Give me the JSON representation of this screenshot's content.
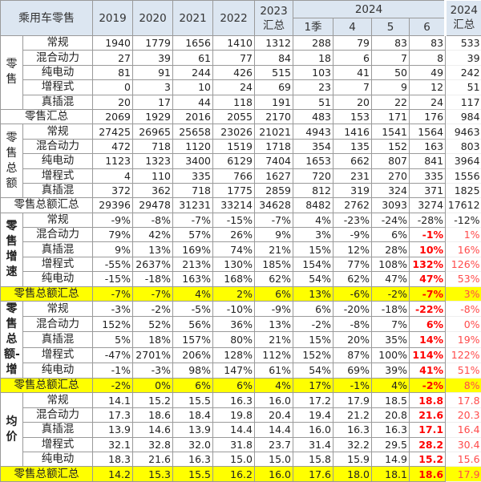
{
  "header": {
    "title": "乘用车零售",
    "years": [
      "2019",
      "2020",
      "2021",
      "2022"
    ],
    "y2023": "2023",
    "y2023_sub": "汇总",
    "y2024": "2024",
    "y2024_subs": [
      "1季",
      "4",
      "5",
      "6"
    ],
    "y2024_total": "2024",
    "y2024_total_sub": "汇总"
  },
  "colors": {
    "highlight_row": "#ffff00",
    "header_bg": "#dce6f1",
    "red": "#ff0000"
  },
  "sections": [
    {
      "label": "零售",
      "rows": [
        {
          "name": "常规",
          "values": [
            "1940",
            "1779",
            "1656",
            "1410",
            "1312",
            "288",
            "79",
            "83",
            "83",
            "533"
          ],
          "red": false
        },
        {
          "name": "混合动力",
          "values": [
            "27",
            "39",
            "61",
            "77",
            "84",
            "18",
            "6",
            "7",
            "8",
            "39"
          ],
          "red": false
        },
        {
          "name": "纯电动",
          "values": [
            "81",
            "91",
            "244",
            "426",
            "515",
            "103",
            "41",
            "50",
            "49",
            "242"
          ],
          "red": false
        },
        {
          "name": "增程式",
          "values": [
            "0",
            "3",
            "10",
            "24",
            "69",
            "23",
            "7",
            "9",
            "12",
            "51"
          ],
          "red": false
        },
        {
          "name": "真插混",
          "values": [
            "20",
            "17",
            "44",
            "118",
            "191",
            "51",
            "20",
            "22",
            "24",
            "117"
          ],
          "red": false
        }
      ],
      "summary": {
        "name": "零售汇总",
        "values": [
          "2069",
          "1929",
          "2016",
          "2055",
          "2170",
          "483",
          "153",
          "171",
          "176",
          "984"
        ],
        "yellow": false,
        "red": false
      }
    },
    {
      "label": "零售总额",
      "rows": [
        {
          "name": "常规",
          "values": [
            "27425",
            "26965",
            "25658",
            "23026",
            "21021",
            "4943",
            "1416",
            "1541",
            "1564",
            "9463"
          ],
          "red": false
        },
        {
          "name": "混合动力",
          "values": [
            "472",
            "718",
            "1120",
            "1519",
            "1718",
            "354",
            "135",
            "152",
            "163",
            "803"
          ],
          "red": false
        },
        {
          "name": "纯电动",
          "values": [
            "1123",
            "1323",
            "3400",
            "6129",
            "7404",
            "1653",
            "662",
            "807",
            "841",
            "3964"
          ],
          "red": false
        },
        {
          "name": "增程式",
          "values": [
            "4",
            "110",
            "335",
            "766",
            "1627",
            "720",
            "231",
            "270",
            "335",
            "1556"
          ],
          "red": false
        },
        {
          "name": "真插混",
          "values": [
            "372",
            "362",
            "718",
            "1775",
            "2859",
            "812",
            "319",
            "324",
            "371",
            "1825"
          ],
          "red": false
        }
      ],
      "summary": {
        "name": "零售总额汇总",
        "values": [
          "29396",
          "29478",
          "31231",
          "33214",
          "34628",
          "8482",
          "2762",
          "3093",
          "3274",
          "17612"
        ],
        "yellow": false,
        "red": false
      }
    },
    {
      "label": "零售增速",
      "rows": [
        {
          "name": "常规",
          "values": [
            "-9%",
            "-8%",
            "-7%",
            "-15%",
            "-7%",
            "4%",
            "-23%",
            "-24%",
            "-28%",
            "-12%"
          ],
          "red": false
        },
        {
          "name": "混合动力",
          "values": [
            "79%",
            "42%",
            "57%",
            "26%",
            "9%",
            "3%",
            "-9%",
            "6%",
            "-1%",
            "1%"
          ],
          "red": true
        },
        {
          "name": "真插混",
          "values": [
            "9%",
            "13%",
            "169%",
            "74%",
            "21%",
            "15%",
            "12%",
            "28%",
            "10%",
            "16%"
          ],
          "red": true
        },
        {
          "name": "增程式",
          "values": [
            "-55%",
            "2637%",
            "213%",
            "130%",
            "185%",
            "154%",
            "77%",
            "108%",
            "132%",
            "126%"
          ],
          "red": true
        },
        {
          "name": "纯电动",
          "values": [
            "-15%",
            "-18%",
            "163%",
            "168%",
            "62%",
            "54%",
            "62%",
            "47%",
            "47%",
            "53%"
          ],
          "red": true
        }
      ],
      "summary": {
        "name": "零售总额汇总",
        "values": [
          "-7%",
          "-7%",
          "4%",
          "2%",
          "6%",
          "13%",
          "-6%",
          "-2%",
          "-7%",
          "3%"
        ],
        "yellow": true,
        "red": true
      }
    },
    {
      "label": "零售总额-增",
      "rows": [
        {
          "name": "常规",
          "values": [
            "-3%",
            "-2%",
            "-5%",
            "-10%",
            "-9%",
            "6%",
            "-20%",
            "-18%",
            "-22%",
            "-8%"
          ],
          "red": true
        },
        {
          "name": "混合动力",
          "values": [
            "152%",
            "52%",
            "56%",
            "36%",
            "13%",
            "-2%",
            "-8%",
            "7%",
            "6%",
            "0%"
          ],
          "red": true
        },
        {
          "name": "真插混",
          "values": [
            "5%",
            "18%",
            "157%",
            "80%",
            "21%",
            "15%",
            "20%",
            "35%",
            "14%",
            "19%"
          ],
          "red": true
        },
        {
          "name": "增程式",
          "values": [
            "-47%",
            "2701%",
            "206%",
            "128%",
            "112%",
            "152%",
            "87%",
            "100%",
            "114%",
            "122%"
          ],
          "red": true
        },
        {
          "name": "纯电动",
          "values": [
            "-1%",
            "-3%",
            "98%",
            "147%",
            "61%",
            "54%",
            "69%",
            "39%",
            "41%",
            "51%"
          ],
          "red": true
        }
      ],
      "summary": {
        "name": "零售总额汇总",
        "values": [
          "-2%",
          "0%",
          "6%",
          "6%",
          "4%",
          "17%",
          "-1%",
          "4%",
          "-2%",
          "8%"
        ],
        "yellow": true,
        "red": true
      }
    },
    {
      "label": "均价",
      "rows": [
        {
          "name": "常规",
          "values": [
            "14.1",
            "15.2",
            "15.5",
            "16.3",
            "16.0",
            "17.2",
            "17.9",
            "18.5",
            "18.8",
            "17.8"
          ],
          "red": true
        },
        {
          "name": "混合动力",
          "values": [
            "17.3",
            "18.6",
            "18.4",
            "19.8",
            "20.4",
            "19.4",
            "21.2",
            "20.8",
            "21.6",
            "20.3"
          ],
          "red": true
        },
        {
          "name": "真插混",
          "values": [
            "13.9",
            "14.6",
            "13.9",
            "14.4",
            "14.4",
            "16.0",
            "16.3",
            "16.3",
            "17.1",
            "16.4"
          ],
          "red": true
        },
        {
          "name": "增程式",
          "values": [
            "32.1",
            "32.8",
            "32.0",
            "31.8",
            "23.7",
            "31.4",
            "32.2",
            "29.5",
            "28.2",
            "30.4"
          ],
          "red": true
        },
        {
          "name": "纯电动",
          "values": [
            "18.3",
            "21.6",
            "16.3",
            "15.0",
            "15.0",
            "15.8",
            "15.9",
            "14.9",
            "15.2",
            "15.6"
          ],
          "red": true
        }
      ],
      "summary": {
        "name": "零售总额汇总",
        "values": [
          "14.2",
          "15.3",
          "15.5",
          "16.2",
          "16.0",
          "17.6",
          "18.0",
          "18.1",
          "18.6",
          "17.9"
        ],
        "yellow": true,
        "red": true
      }
    }
  ]
}
